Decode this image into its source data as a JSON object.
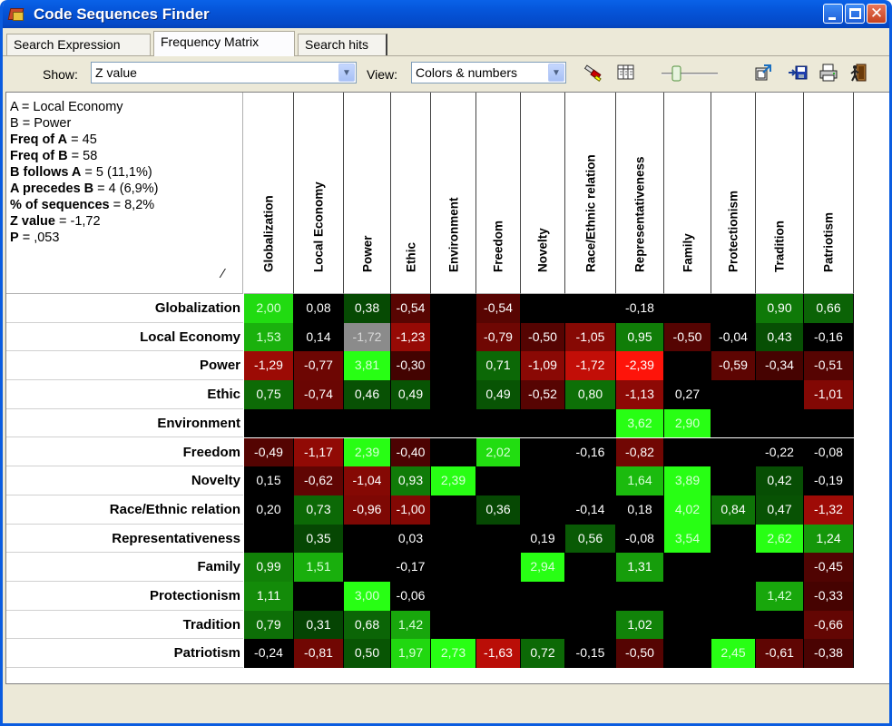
{
  "window": {
    "title": "Code Sequences Finder"
  },
  "tabs": [
    "Search Expression",
    "Frequency Matrix",
    "Search hits"
  ],
  "toolbar": {
    "show_label": "Show:",
    "show_value": "Z value",
    "view_label": "View:",
    "view_value": "Colors & numbers",
    "icons": [
      "highlighter-icon",
      "columns-icon",
      "slider-icon",
      "export-icon",
      "save-icon",
      "print-icon",
      "exit-icon"
    ]
  },
  "info": {
    "a": "A = Local Economy",
    "b": "B = Power",
    "freq_a_label": "Freq of A",
    "freq_a": " = 45",
    "freq_b_label": "Freq of B",
    "freq_b": " = 58",
    "follows_label": "B follows A",
    "follows": " = 5 (11,1%)",
    "precedes_label": "A precedes B",
    "precedes": " = 4 (6,9%)",
    "pct_label": "% of sequences",
    "pct": " = 8,2%",
    "z_label": "Z value",
    "z": " = -1,72",
    "p_label": "P",
    "p": " = ,053"
  },
  "matrix": {
    "columns": [
      "Globalization",
      "Local Economy",
      "Power",
      "Ethic",
      "Environment",
      "Freedom",
      "Novelty",
      "Race/Ethnic relation",
      "Representativeness",
      "Family",
      "Protectionism",
      "Tradition",
      "Patriotism"
    ],
    "rows": [
      {
        "label": "Globalization",
        "values": [
          "2,00",
          "0,08",
          "0,38",
          "-0,54",
          "",
          "-0,54",
          "",
          "",
          "-0,18",
          "",
          "",
          "0,90",
          "0,66"
        ]
      },
      {
        "label": "Local Economy",
        "values": [
          "1,53",
          "0,14",
          "-1,72",
          "-1,23",
          "",
          "-0,79",
          "-0,50",
          "-1,05",
          "0,95",
          "-0,50",
          "-0,04",
          "0,43",
          "-0,16"
        ]
      },
      {
        "label": "Power",
        "values": [
          "-1,29",
          "-0,77",
          "3,81",
          "-0,30",
          "",
          "0,71",
          "-1,09",
          "-1,72",
          "-2,39",
          "",
          "-0,59",
          "-0,34",
          "-0,51"
        ]
      },
      {
        "label": "Ethic",
        "values": [
          "0,75",
          "-0,74",
          "0,46",
          "0,49",
          "",
          "0,49",
          "-0,52",
          "0,80",
          "-1,13",
          "0,27",
          "",
          "",
          "-1,01"
        ]
      },
      {
        "label": "Environment",
        "values": [
          "",
          "",
          "",
          "",
          "",
          "",
          "",
          "",
          "3,62",
          "2,90",
          "",
          "",
          ""
        ]
      },
      {
        "label": "Freedom",
        "values": [
          "-0,49",
          "-1,17",
          "2,39",
          "-0,40",
          "",
          "2,02",
          "",
          "-0,16",
          "-0,82",
          "",
          "",
          "-0,22",
          "-0,08"
        ]
      },
      {
        "label": "Novelty",
        "values": [
          "0,15",
          "-0,62",
          "-1,04",
          "0,93",
          "2,39",
          "",
          "",
          "",
          "1,64",
          "3,89",
          "",
          "0,42",
          "-0,19"
        ]
      },
      {
        "label": "Race/Ethnic relation",
        "values": [
          "0,20",
          "0,73",
          "-0,96",
          "-1,00",
          "",
          "0,36",
          "",
          "-0,14",
          "0,18",
          "4,02",
          "0,84",
          "0,47",
          "-1,32"
        ]
      },
      {
        "label": "Representativeness",
        "values": [
          "",
          "0,35",
          "",
          "0,03",
          "",
          "",
          "0,19",
          "0,56",
          "-0,08",
          "3,54",
          "",
          "2,62",
          "1,24"
        ]
      },
      {
        "label": "Family",
        "values": [
          "0,99",
          "1,51",
          "",
          "-0,17",
          "",
          "",
          "2,94",
          "",
          "1,31",
          "",
          "",
          "",
          "-0,45"
        ]
      },
      {
        "label": "Protectionism",
        "values": [
          "1,11",
          "",
          "3,00",
          "-0,06",
          "",
          "",
          "",
          "",
          "",
          "",
          "",
          "1,42",
          "-0,33"
        ]
      },
      {
        "label": "Tradition",
        "values": [
          "0,79",
          "0,31",
          "0,68",
          "1,42",
          "",
          "",
          "",
          "",
          "1,02",
          "",
          "",
          "",
          "-0,66"
        ]
      },
      {
        "label": "Patriotism",
        "values": [
          "-0,24",
          "-0,81",
          "0,50",
          "1,97",
          "2,73",
          "-1,63",
          "0,72",
          "-0,15",
          "-0,50",
          "",
          "2,45",
          "-0,61",
          "-0,38"
        ]
      }
    ],
    "selected": {
      "row": 1,
      "col": 2
    },
    "colors": {
      "positive": "#00ff00",
      "negative": "#ff0000",
      "neutral": "#000000",
      "selected": "#8b8b8b"
    }
  }
}
